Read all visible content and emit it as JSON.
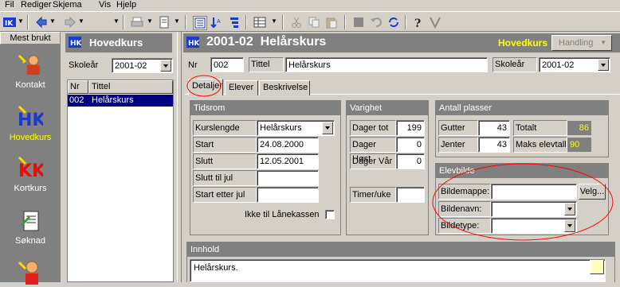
{
  "menu": [
    "Fil",
    "Rediger",
    "Skjema",
    "Vis",
    "Hjelp"
  ],
  "colors": {
    "face": "#d4d0c8",
    "shadow": "#808080",
    "title_yellow": "#ffff00",
    "annotation": "#ff0000",
    "selection": "#000080"
  },
  "sidebar": {
    "header": "Mest brukt",
    "items": [
      {
        "label": "Kontakt",
        "icon": "contact-icon"
      },
      {
        "label": "Hovedkurs",
        "icon": "hk-icon",
        "active": true
      },
      {
        "label": "Kortkurs",
        "icon": "kk-icon"
      },
      {
        "label": "Søknad",
        "icon": "application-icon"
      },
      {
        "label": "",
        "icon": "person-icon"
      }
    ]
  },
  "list_panel": {
    "title": "Hovedkurs",
    "skolear_label": "Skoleår",
    "skolear_value": "2001-02",
    "col_nr": "Nr",
    "col_tittel": "Tittel",
    "rows": [
      {
        "nr": "002",
        "tittel": "Helårskurs"
      }
    ]
  },
  "detail": {
    "title": "2001-02  Helårskurs",
    "module_label": "Hovedkurs",
    "action_label": "Handling",
    "nr_label": "Nr",
    "nr_value": "002",
    "tittel_label": "Tittel",
    "tittel_value": "Helårskurs",
    "skolear_label": "Skoleår",
    "skolear_value": "2001-02",
    "tabs": [
      "Detaljer",
      "Elever",
      "Beskrivelse"
    ],
    "tidsrom": {
      "title": "Tidsrom",
      "rows": [
        {
          "label": "Kurslengde",
          "value": "Helårskurs"
        },
        {
          "label": "Start",
          "value": "24.08.2000"
        },
        {
          "label": "Slutt",
          "value": "12.05.2001"
        },
        {
          "label": "Slutt til jul",
          "value": ""
        },
        {
          "label": "Start etter jul",
          "value": ""
        }
      ],
      "checkbox_label": "Ikke til Lånekassen"
    },
    "varighet": {
      "title": "Varighet",
      "rows": [
        {
          "label": "Dager tot",
          "value": "199"
        },
        {
          "label": "Dager Høst",
          "value": "0"
        },
        {
          "label": "Dager Vår",
          "value": "0"
        }
      ],
      "timer_label": "Timer/uke",
      "timer_value": ""
    },
    "plasser": {
      "title": "Antall plasser",
      "gutter_label": "Gutter",
      "gutter_value": "43",
      "jenter_label": "Jenter",
      "jenter_value": "43",
      "totalt_label": "Totalt",
      "totalt_value": "86",
      "maks_label": "Maks elevtall",
      "maks_value": "90"
    },
    "elevbilde": {
      "title": "Elevbilde",
      "mappe_label": "Bildemappe:",
      "navn_label": "Bildenavn:",
      "type_label": "Bildetype:",
      "velg_label": "Velg..."
    },
    "innhold": {
      "title": "Innhold",
      "text": "Helårskurs."
    }
  }
}
